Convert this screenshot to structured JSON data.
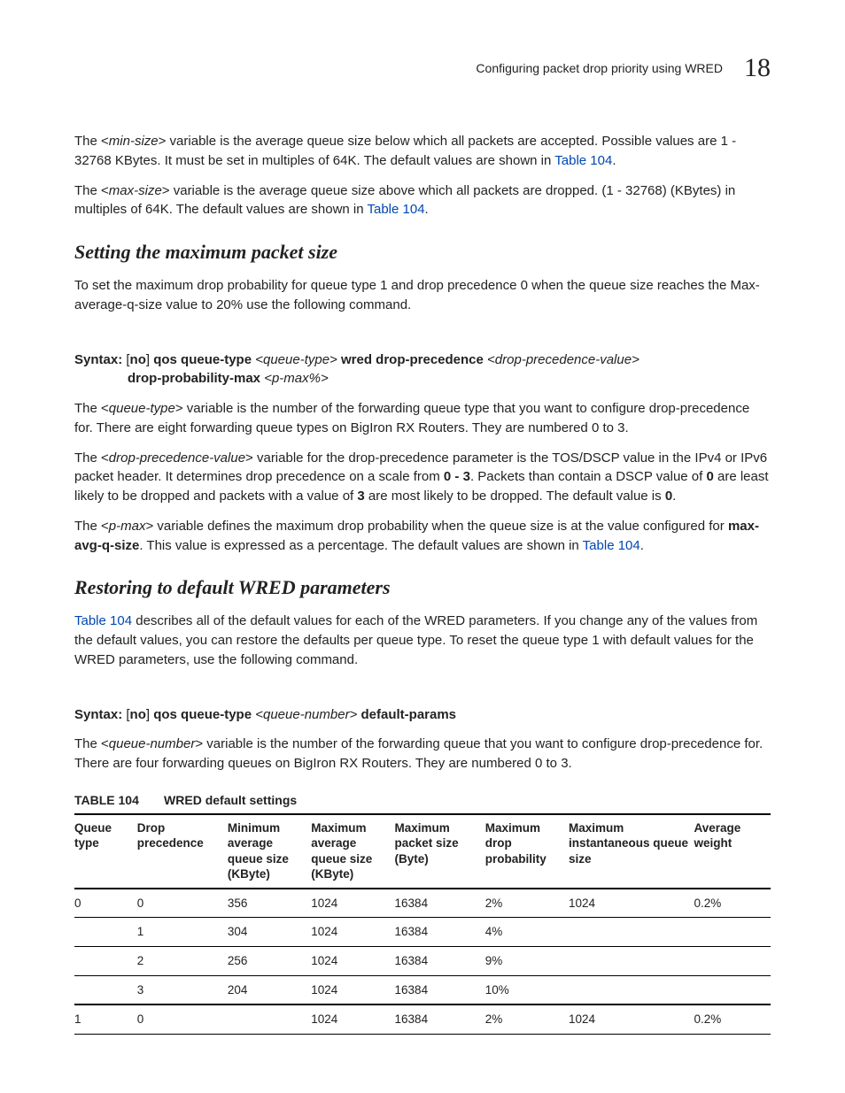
{
  "header": {
    "title": "Configuring packet drop priority using WRED",
    "chapter_num": "18"
  },
  "p1a": "The <",
  "p1_var": "min-size",
  "p1b": "> variable is the average queue size below which all packets are accepted. Possible values are 1 - 32768 KBytes. It must be set in multiples of 64K. The default values are shown in ",
  "p1_link": "Table 104",
  "p1c": ".",
  "p2a": "The <",
  "p2_var": "max-size",
  "p2b": "> variable is the average queue size above which all packets are dropped. (1 - 32768) (KBytes) in multiples of 64K. The default values are shown in ",
  "p2_link": "Table 104",
  "p2c": ".",
  "h1": "Setting the maximum packet size",
  "p3": "To set the maximum drop probability for queue type 1 and drop precedence 0 when the queue size reaches the Max-average-q-size value to 20% use the following command.",
  "syntax1": {
    "label": "Syntax:",
    "no": "no",
    "t1": "qos queue-type",
    "v1": "<queue-type>",
    "t2": "wred drop-precedence",
    "v2": "<drop-precedence-value>",
    "t3": "drop-probability-max",
    "v3": "<p-max%>"
  },
  "p4a": "The <",
  "p4_var": "queue-type",
  "p4b": "> variable is the number of the forwarding queue type that you want to configure drop-precedence for. There are eight forwarding queue types on BigIron RX Routers. They are numbered 0 to 3.",
  "p5a": "The <",
  "p5_var": "drop-precedence-value",
  "p5b": "> variable for the drop-precedence parameter is the TOS/DSCP value in the IPv4 or IPv6 packet header. It determines drop precedence on a scale from ",
  "p5_b1": "0 - 3",
  "p5c": ". Packets than contain a DSCP value of ",
  "p5_b2": "0",
  "p5d": " are least likely to be dropped and packets with a value of ",
  "p5_b3": "3",
  "p5e": " are most likely to be dropped. The default value is ",
  "p5_b4": "0",
  "p5f": ".",
  "p6a": "The <",
  "p6_var": "p-max",
  "p6b": "> variable defines the maximum drop probability when the queue size is at the value configured for ",
  "p6_b1": "max-avg-q-size",
  "p6c": ". This value is expressed as a percentage. The default values are shown in ",
  "p6_link": "Table 104",
  "p6d": ".",
  "h2": "Restoring to default WRED parameters",
  "p7_link": "Table 104",
  "p7": " describes all of the default values for each of the WRED parameters. If you change any of the values from the default values, you can restore the defaults per queue type. To reset the queue type 1 with default values for the WRED parameters, use the following command.",
  "syntax2": {
    "label": "Syntax:",
    "no": "no",
    "t1": "qos queue-type",
    "v1": "<queue-number>",
    "t2": "default-params"
  },
  "p8a": "The <",
  "p8_var": "queue-number",
  "p8b": "> variable is the number of the forwarding queue that you want to configure drop-precedence for. There are four forwarding queues on BigIron RX Routers. They are numbered 0 to 3.",
  "table": {
    "label": "TABLE 104",
    "caption": "WRED default settings",
    "headers": [
      "Queue type",
      "Drop precedence",
      "Minimum average queue size (KByte)",
      "Maximum average queue size (KByte)",
      "Maximum packet size (Byte)",
      "Maximum drop probability",
      "Maximum instantaneous queue size",
      "Average weight"
    ],
    "rows": [
      {
        "cells": [
          "0",
          "0",
          "356",
          "1024",
          "16384",
          "2%",
          "1024",
          "0.2%"
        ],
        "class": ""
      },
      {
        "cells": [
          "",
          "1",
          "304",
          "1024",
          "16384",
          "4%",
          "",
          ""
        ],
        "class": "sub"
      },
      {
        "cells": [
          "",
          "2",
          "256",
          "1024",
          "16384",
          "9%",
          "",
          ""
        ],
        "class": "sub"
      },
      {
        "cells": [
          "",
          "3",
          "204",
          "1024",
          "16384",
          "10%",
          "",
          ""
        ],
        "class": "groupend"
      },
      {
        "cells": [
          "1",
          "0",
          "",
          "1024",
          "16384",
          "2%",
          "1024",
          "0.2%"
        ],
        "class": ""
      }
    ]
  }
}
